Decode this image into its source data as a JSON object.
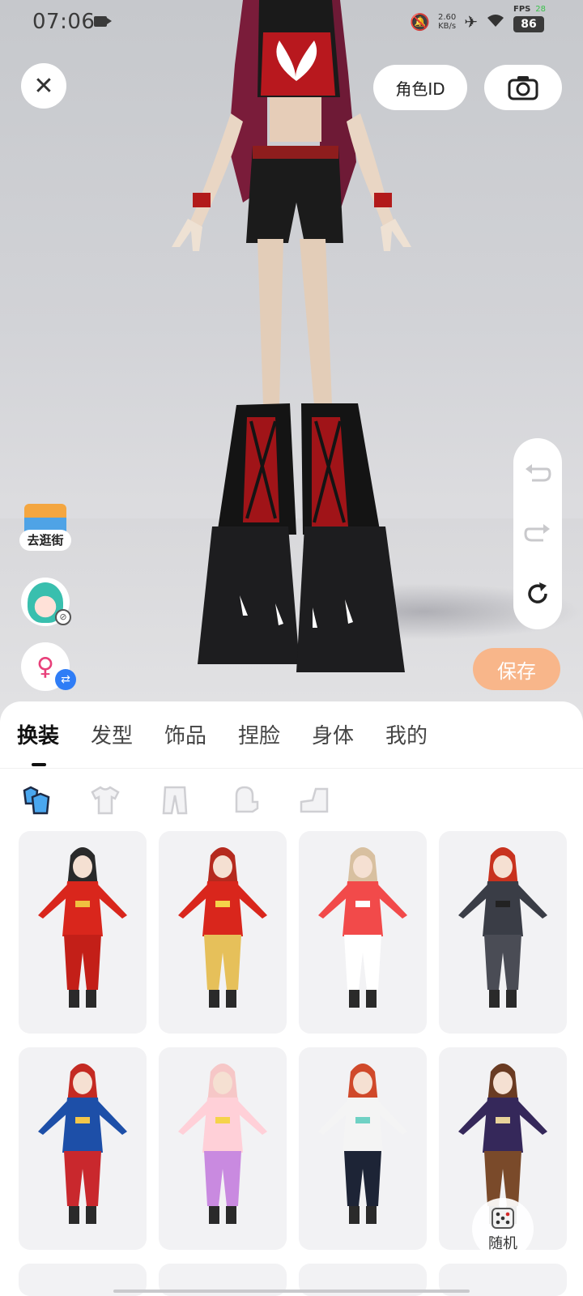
{
  "status_bar": {
    "time": "07:06",
    "net_speed": "2.60",
    "net_unit": "KB/s",
    "fps_label": "FPS",
    "fps_value": "28",
    "battery": "86"
  },
  "top": {
    "role_id_label": "角色ID"
  },
  "left_actions": {
    "shop_label": "去逛街"
  },
  "save_label": "保存",
  "tabs": [
    "换装",
    "发型",
    "饰品",
    "捏脸",
    "身体",
    "我的"
  ],
  "active_tab": "换装",
  "subtabs": [
    "outfit-set-icon",
    "top-icon",
    "pants-icon",
    "gloves-icon",
    "shoes-icon"
  ],
  "outfits": [
    {
      "name": "outfit-1",
      "hair": "#2a2a2a",
      "top": "#d9261c",
      "bottom": "#c31f18",
      "accent": "#f0c040"
    },
    {
      "name": "outfit-2",
      "hair": "#b52a1e",
      "top": "#d9261c",
      "bottom": "#e6c05a",
      "accent": "#f5d34a"
    },
    {
      "name": "outfit-3",
      "hair": "#d8c0a0",
      "top": "#f24a4a",
      "bottom": "#ffffff",
      "accent": "#ffffff"
    },
    {
      "name": "outfit-4",
      "hair": "#c8321e",
      "top": "#3a3d46",
      "bottom": "#4a4c55",
      "accent": "#222"
    },
    {
      "name": "outfit-5",
      "hair": "#c42a22",
      "top": "#1d4fa8",
      "bottom": "#c9282d",
      "accent": "#f3c64a"
    },
    {
      "name": "outfit-6",
      "hair": "#f6c7c7",
      "top": "#ffd0d8",
      "bottom": "#c98ae0",
      "accent": "#f5d34a"
    },
    {
      "name": "outfit-7",
      "hair": "#d0492a",
      "top": "#f4f4f4",
      "bottom": "#1d2436",
      "accent": "#6fd1c4"
    },
    {
      "name": "outfit-8",
      "hair": "#6a3b22",
      "top": "#35285a",
      "bottom": "#7a4a2a",
      "accent": "#e8d39a"
    }
  ],
  "random_label": "随机",
  "colors": {
    "save_button": "#f8b68a",
    "gender_icon": "#e8407a",
    "swap_badge": "#2f7df6"
  }
}
